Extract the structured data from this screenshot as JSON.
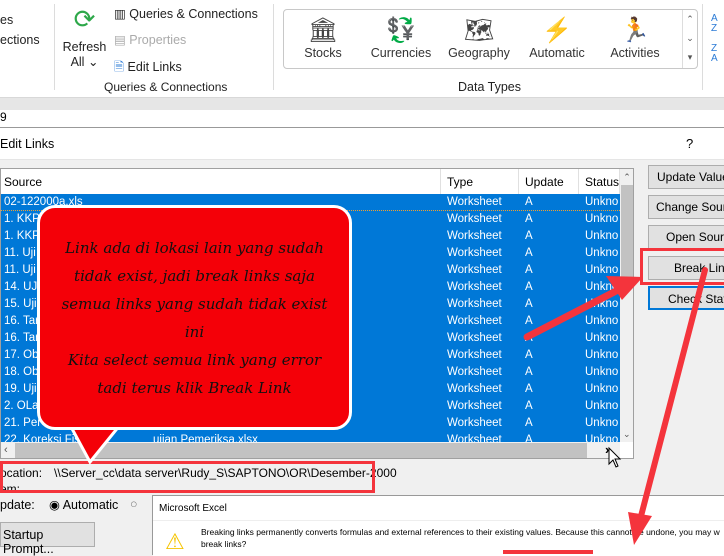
{
  "ribbon": {
    "left_partial": [
      "es",
      "ections"
    ],
    "refresh_label": "Refresh",
    "refresh_all": "All",
    "queries_connections": "Queries & Connections",
    "properties": "Properties",
    "edit_links": "Edit Links",
    "group_queries": "Queries & Connections",
    "data_types": [
      {
        "label": "Stocks",
        "icon": "bank-icon"
      },
      {
        "label": "Currencies",
        "icon": "currency-icon"
      },
      {
        "label": "Geography",
        "icon": "map-icon"
      },
      {
        "label": "Automatic",
        "icon": "lightning-icon"
      },
      {
        "label": "Activities",
        "icon": "running-person-icon"
      }
    ],
    "group_data_types": "Data Types",
    "sort_az": "A Z",
    "sort_za": "Z A"
  },
  "formula_bar": {
    "cell": "9"
  },
  "dialog": {
    "title": "Edit Links",
    "help": "?",
    "columns": [
      "Source",
      "Type",
      "Update",
      "Status"
    ],
    "rows": [
      {
        "source": "02-122000a.xls",
        "type": "Worksheet",
        "update": "A",
        "status": "Unkno"
      },
      {
        "source": "1. KKP",
        "type": "Worksheet",
        "update": "A",
        "status": "Unkno"
      },
      {
        "source": "1. KKP_",
        "type": "Worksheet",
        "update": "A",
        "status": "Unkno"
      },
      {
        "source": "11. Uji",
        "type": "Worksheet",
        "update": "A",
        "status": "Unkno"
      },
      {
        "source": "11. Uji",
        "type": "Worksheet",
        "update": "A",
        "status": "Unkno"
      },
      {
        "source": "14. UJi",
        "type": "Worksheet",
        "update": "A",
        "status": "Unkno"
      },
      {
        "source": "15. Uji",
        "type": "Worksheet",
        "update": "A",
        "status": "Unkno"
      },
      {
        "source": "16. Tar",
        "type": "Worksheet",
        "update": "A",
        "status": "Unkno"
      },
      {
        "source": "16. Tar",
        "type": "Worksheet",
        "update": "A",
        "status": "Unkno"
      },
      {
        "source": "17. Ob",
        "type": "Worksheet",
        "update": "A",
        "status": "Unkno"
      },
      {
        "source": "18. Ob",
        "type": "Worksheet",
        "update": "A",
        "status": "Unkno"
      },
      {
        "source": "19. Uji",
        "type": "Worksheet",
        "update": "A",
        "status": "Unkno"
      },
      {
        "source": "2. OLa",
        "type": "Worksheet",
        "update": "A",
        "status": "Unkno"
      },
      {
        "source": "21. Per",
        "type": "Worksheet",
        "update": "A",
        "status": "Unkno"
      },
      {
        "source": "22. Koreksi Fis",
        "source_tail": "ujian Pemeriksa.xlsx",
        "type": "Worksheet",
        "update": "A",
        "status": "Unkno"
      }
    ],
    "buttons": [
      "Update Values",
      "Change Source",
      "Open Source",
      "Break Link",
      "Check Status"
    ],
    "location_label": "ocation:",
    "location_value": "\\\\Server_cc\\data server\\Rudy_S\\SAPTONO\\OR\\Desember-2000",
    "item_label": "em:",
    "update_label": "pdate:",
    "update_automatic": "Automatic",
    "update_selected": "Automatic",
    "startup_prompt": "Startup Prompt..."
  },
  "callout": {
    "lines": [
      "Link ada di lokasi lain yang sudah",
      "tidak exist, jadi break links saja",
      "semua links yang sudah tidak exist",
      "ini",
      "Kita select semua link yang error",
      "tadi terus klik Break Link"
    ]
  },
  "excel_dialog": {
    "title": "Microsoft Excel",
    "message": "Breaking links permanently converts formulas and external references to their existing values. Because this cannot be undone, you may w",
    "message2": "break links?"
  },
  "colors": {
    "selection": "#0078d7",
    "annotation": "#f4343c",
    "callout": "#f40008"
  }
}
